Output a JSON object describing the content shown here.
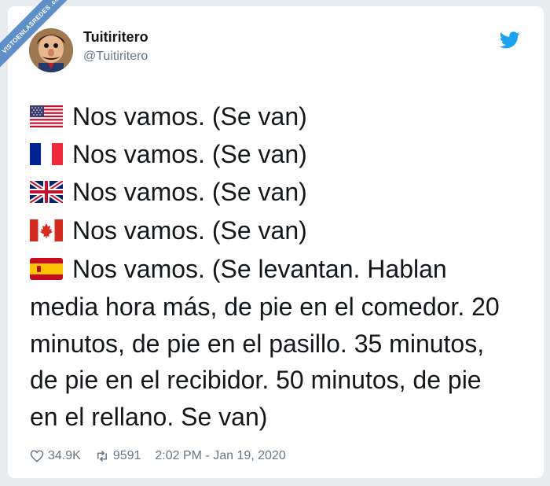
{
  "watermark": "VISTOENLASREDES .com",
  "author": {
    "name": "Tuitiritero",
    "handle": "@Tuitiritero"
  },
  "lines": [
    {
      "flag": "us-flag-icon",
      "text": "Nos vamos. (Se van)"
    },
    {
      "flag": "france-flag-icon",
      "text": "Nos vamos. (Se van)"
    },
    {
      "flag": "uk-flag-icon",
      "text": "Nos vamos. (Se van)"
    },
    {
      "flag": "canada-flag-icon",
      "text": "Nos vamos. (Se van)"
    }
  ],
  "spain": {
    "flag": "spain-flag-icon",
    "lines": [
      "Nos vamos. (Se levantan. Hablan",
      "media hora más, de pie en el comedor. 20",
      "minutos, de pie en el pasillo. 35 minutos,",
      "de pie en el recibidor. 50 minutos, de pie",
      "en el rellano. Se van)"
    ]
  },
  "footer": {
    "likes": "34.9K",
    "retweets": "9591",
    "timestamp": "2:02 PM - Jan 19, 2020"
  },
  "colors": {
    "twitter_blue": "#1da1f2",
    "text": "#14171a",
    "muted": "#657786"
  }
}
